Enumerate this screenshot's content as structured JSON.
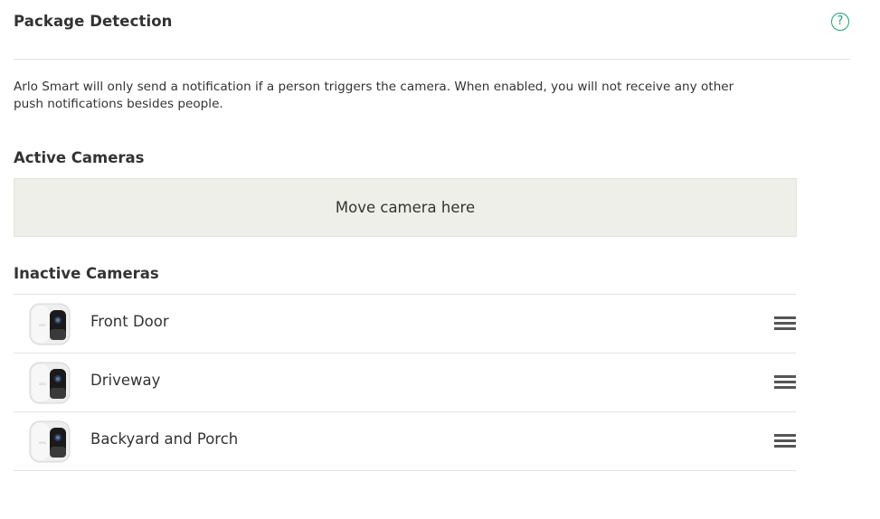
{
  "header": {
    "title": "Package Detection",
    "help_icon": "?"
  },
  "description": "Arlo Smart will only send a notification if a person triggers the camera. When enabled, you will not receive any other push notifications besides people.",
  "active_section": {
    "label": "Active Cameras",
    "dropzone_text": "Move camera here"
  },
  "inactive_section": {
    "label": "Inactive Cameras",
    "cameras": [
      {
        "name": "Front Door",
        "icon": "camera-icon",
        "handle_icon": "drag-handle-icon"
      },
      {
        "name": "Driveway",
        "icon": "camera-icon",
        "handle_icon": "drag-handle-icon"
      },
      {
        "name": "Backyard and Porch",
        "icon": "camera-icon",
        "handle_icon": "drag-handle-icon"
      }
    ]
  },
  "colors": {
    "accent": "#1aa56b",
    "dropzone_bg": "#efefea",
    "text": "#333333"
  }
}
